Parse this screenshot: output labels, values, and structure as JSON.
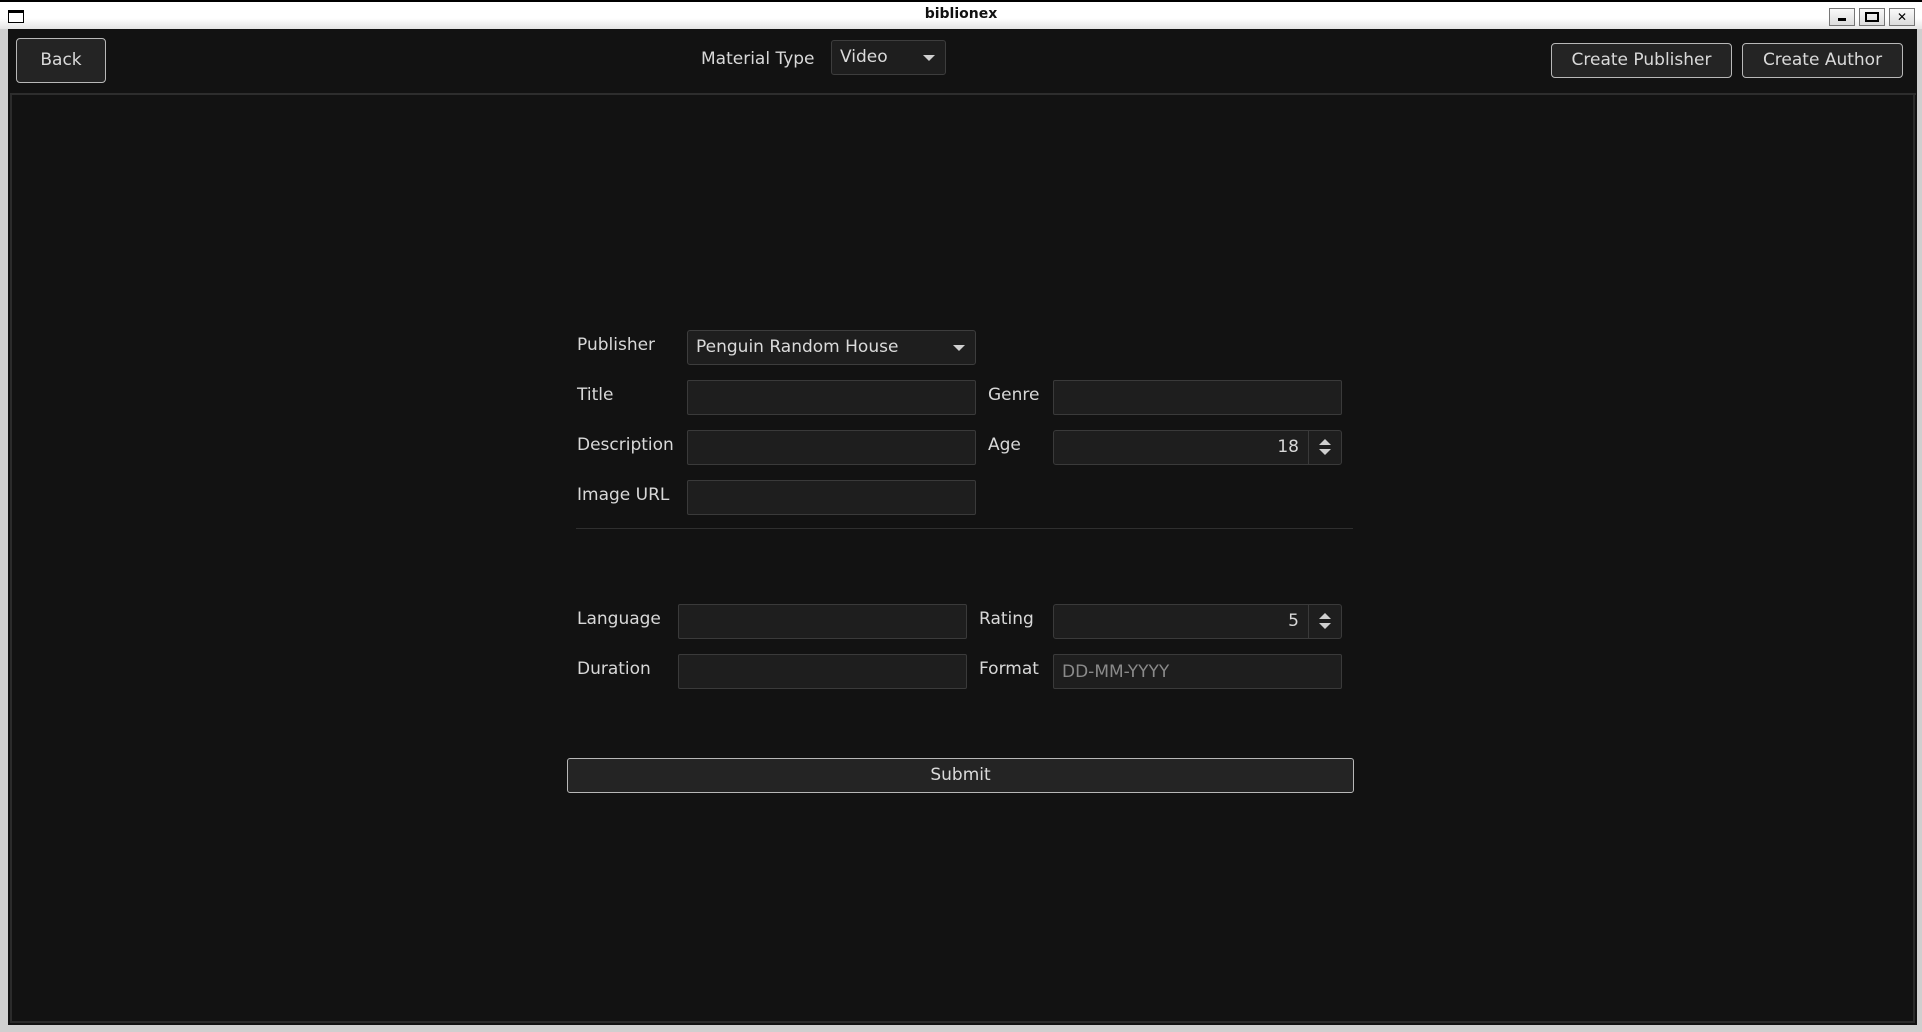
{
  "window": {
    "title": "biblionex",
    "controls": {
      "minimize": "_",
      "maximize": "□",
      "close": "✕"
    }
  },
  "header": {
    "back_label": "Back",
    "material_type_label": "Material Type",
    "material_type_value": "Video",
    "create_publisher_label": "Create Publisher",
    "create_author_label": "Create Author"
  },
  "form": {
    "publisher": {
      "label": "Publisher",
      "value": "Penguin Random House"
    },
    "title": {
      "label": "Title",
      "value": "",
      "placeholder": ""
    },
    "genre": {
      "label": "Genre",
      "value": "",
      "placeholder": ""
    },
    "description": {
      "label": "Description",
      "value": "",
      "placeholder": ""
    },
    "age": {
      "label": "Age",
      "value": "18"
    },
    "image_url": {
      "label": "Image URL",
      "value": "",
      "placeholder": ""
    },
    "language": {
      "label": "Language",
      "value": "",
      "placeholder": ""
    },
    "rating": {
      "label": "Rating",
      "value": "5"
    },
    "duration": {
      "label": "Duration",
      "value": "",
      "placeholder": ""
    },
    "format": {
      "label": "Format",
      "value": "",
      "placeholder": "DD-MM-YYYY"
    },
    "submit_label": "Submit"
  },
  "colors": {
    "background": "#121212",
    "field_background": "#1e1e1e",
    "button_background": "#242424",
    "text": "#d8d8d8"
  }
}
